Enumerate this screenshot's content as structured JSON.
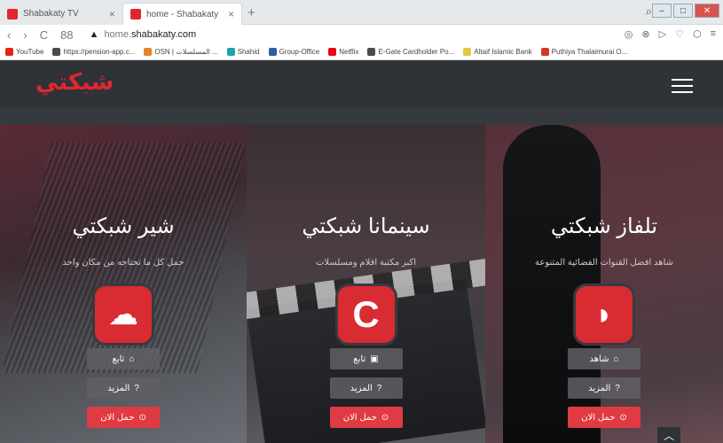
{
  "browser": {
    "tabs": [
      {
        "label": "Shabakaty TV",
        "close": "×",
        "color": "#e3262e"
      },
      {
        "label": "home - Shabakaty",
        "close": "×",
        "color": "#e3262e"
      }
    ],
    "new_tab": "+",
    "window_controls": {
      "minimize": "–",
      "maximize": "□",
      "close": "✕"
    },
    "nav": {
      "back": "‹",
      "forward": "›",
      "reload": "C",
      "apps": "88"
    },
    "url_prefix": "home.",
    "url_domain": "shabakaty.com",
    "security_icon": "▲",
    "toolbar_icons": [
      "◎",
      "⊗",
      "▷",
      "♡",
      "⬡",
      "≡"
    ],
    "bookmarks": [
      {
        "label": "YouTube",
        "color": "#e62117"
      },
      {
        "label": "https://pension-app.c...",
        "color": "#4a4a4a"
      },
      {
        "label": "OSN | المسلسلات ...",
        "color": "#e2862a"
      },
      {
        "label": "Shahid",
        "color": "#1aa3b0"
      },
      {
        "label": "Group-Office",
        "color": "#2b5fa8"
      },
      {
        "label": "Netflix",
        "color": "#e50914"
      },
      {
        "label": "E-Gate Cardholder Po...",
        "color": "#4a4a4a"
      },
      {
        "label": "Altaif Islamic Bank",
        "color": "#e4c44a"
      },
      {
        "label": "Puthiya Thalaimurai O...",
        "color": "#cf3b26"
      }
    ]
  },
  "site": {
    "logo": "شبكتي",
    "brand_color": "#e3262e",
    "panels": [
      {
        "title": "شير شبكتي",
        "subtitle": "حمل كل ما تحتاجه من مكان واحد",
        "icon": "☁",
        "buttons": [
          {
            "label": "تابع",
            "icon": "⌂"
          },
          {
            "label": "المزيد",
            "icon": "?"
          },
          {
            "label": "حمل الان",
            "icon": "⊙"
          }
        ]
      },
      {
        "title": "سينمانا شبكتي",
        "subtitle": "اكبر مكتبة افلام ومسلسلات",
        "icon": "C",
        "buttons": [
          {
            "label": "تابع",
            "icon": "▣"
          },
          {
            "label": "المزيد",
            "icon": "?"
          },
          {
            "label": "حمل الان",
            "icon": "⊙"
          }
        ]
      },
      {
        "title": "تلفاز شبكتي",
        "subtitle": "شاهد افضل القنوات الفضائية المتنوعة",
        "icon": "◗",
        "buttons": [
          {
            "label": "شاهد",
            "icon": "⌂"
          },
          {
            "label": "المزيد",
            "icon": "?"
          },
          {
            "label": "حمل الان",
            "icon": "⊙"
          }
        ]
      }
    ],
    "scroll_top": "︿"
  }
}
